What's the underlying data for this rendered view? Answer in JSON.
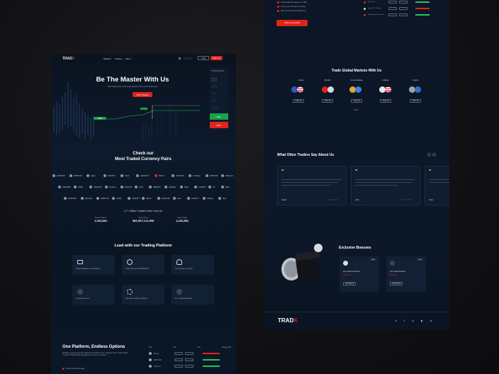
{
  "brand": {
    "name_main": "TRAD",
    "name_accent": "X"
  },
  "nav": {
    "links": [
      "Markets",
      "Trading",
      "About"
    ],
    "login_label": "Login",
    "signup_label": "Sign Up"
  },
  "hero": {
    "title": "Be The Master With Us",
    "subtitle": "Start Trading the world's best platform with your favorite pairs",
    "cta_label": "Start Trading",
    "buy_label": "BUY",
    "sell_label": "SELL",
    "tag_price": "1.0854"
  },
  "pairs_section": {
    "title_line1": "Check our",
    "title_line2": "Most Traded Currency Pairs",
    "row1": [
      "EUR/USD",
      "GBP/USD",
      "Apple",
      "USD/JPY",
      "Tesla",
      "AUD/USD",
      "Bitcoin",
      "USD/CAD",
      "Coinbase",
      "NZD/USD",
      "Ethereum"
    ],
    "row2": [
      "EUR/GBP",
      "Netflix",
      "USD/CHF",
      "Amazon",
      "EUR/JPY",
      "Gold",
      "GBP/JPY",
      "Alphabet",
      "Silver",
      "AUD/JPY",
      "Oil",
      "Meta"
    ],
    "row3": [
      "EUR/CAD",
      "Microsoft",
      "GBP/CHF",
      "Nvidia",
      "CAD/JPY",
      "Adobe",
      "EUR/AUD",
      "Intel",
      "CHF/JPY",
      "Shopify",
      "Visa"
    ]
  },
  "stats": {
    "headline": "4.7+ Million Traders Who Trust Us",
    "items": [
      {
        "label": "Active Traders",
        "value": "1,432,884"
      },
      {
        "label": "Total Volume",
        "value": "$66,837,141,555"
      },
      {
        "label": "Total Trades",
        "value": "1,432,884"
      }
    ]
  },
  "platform": {
    "title": "Lead with our Trading Platform",
    "features": [
      "Rapid Registration & Verification",
      "Instant Deposits & Withdrawals",
      "24/7 Customer Support",
      "Transparent Fees",
      "Favorable Trading Conditions",
      "Free Trading Materials"
    ]
  },
  "options": {
    "title": "One Platform, Endless Options",
    "body": "Whether you're interested in trading commodities, forex, cryptocurrencies, stock indices or stocks, TRADX offers everything you need in one place.",
    "bullet": "Trade flexible leverage",
    "table_headers": [
      "Pair",
      "Sell",
      "Buy",
      "Change 24h"
    ],
    "rows": [
      "Bitcoin",
      "EUR/USD",
      "Apple Inc"
    ]
  },
  "top_right": {
    "bullets": [
      "Trade flexible leverage up to 1:500",
      "Access over 100 pairs for trading",
      "Tight spreads with no hidden fees"
    ],
    "cta_label": "Trade Commodities",
    "rows": [
      "France 40",
      "Cyprus 20 - Futures",
      "Hong Kong 50 - Futures"
    ]
  },
  "markets": {
    "title": "Trade Global Markets With Us",
    "categories": [
      "Forex",
      "Stocks",
      "Commodities",
      "Indices",
      "Crypto"
    ],
    "button_label": "View All"
  },
  "testimonials": {
    "title": "What Other Traders Say About Us",
    "names": [
      "Sarah",
      "John",
      "Peter"
    ]
  },
  "bonuses": {
    "title": "Exclusive Bonuses",
    "cards": [
      {
        "title": "Get a Welcome Bonus",
        "value": "$25 USD",
        "badge": "NEW",
        "button": "Get Bonus"
      },
      {
        "title": "Free Trade Rewards",
        "value": "$25 USD",
        "badge": "NEW",
        "button": "Get Bonus"
      }
    ]
  },
  "footer": {
    "brand_main": "TRAD",
    "brand_accent": "X",
    "social": [
      "x-icon",
      "facebook-icon",
      "instagram-icon",
      "youtube-icon",
      "linkedin-icon"
    ]
  },
  "colors": {
    "accent": "#e2231a",
    "bg": "#0b1422",
    "green": "#22c55e"
  }
}
